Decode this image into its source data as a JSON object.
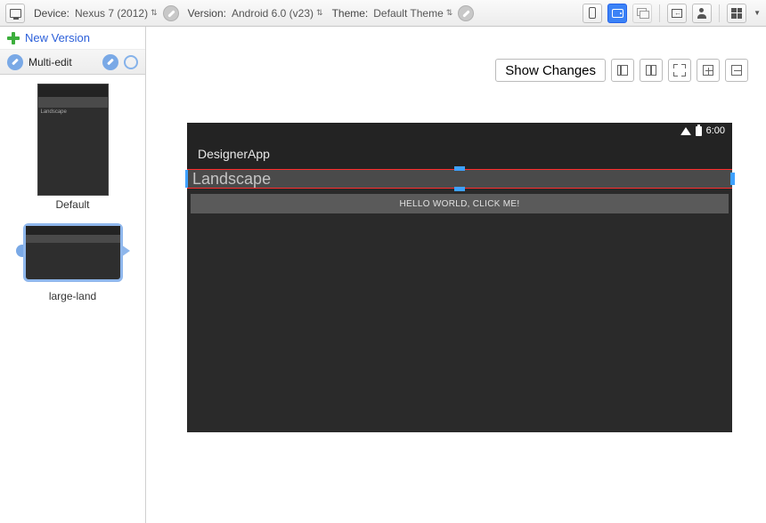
{
  "toolbar": {
    "device_label": "Device:",
    "device_value": "Nexus 7 (2012)",
    "version_label": "Version:",
    "version_value": "Android 6.0 (v23)",
    "theme_label": "Theme:",
    "theme_value": "Default Theme"
  },
  "sidebar": {
    "new_version": "New Version",
    "multi_edit": "Multi-edit",
    "thumbs": [
      {
        "label": "Default"
      },
      {
        "label": "large-land"
      }
    ]
  },
  "canvas": {
    "show_changes": "Show Changes"
  },
  "device_preview": {
    "clock": "6:00",
    "app_title": "DesignerApp",
    "selected_text": "Landscape",
    "button_text": "HELLO WORLD, CLICK ME!"
  }
}
